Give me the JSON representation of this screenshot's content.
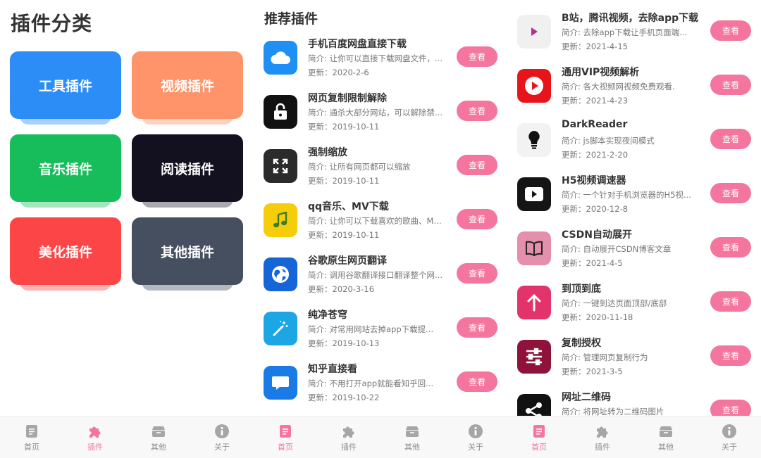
{
  "screen1": {
    "title": "插件分类",
    "categories": [
      {
        "label": "工具插件",
        "color": "#2d8df6",
        "shadow": "#a9d0fb"
      },
      {
        "label": "视频插件",
        "color": "#ff946b",
        "shadow": "#ffd2c0"
      },
      {
        "label": "音乐插件",
        "color": "#17bd5a",
        "shadow": "#a3e6bd"
      },
      {
        "label": "阅读插件",
        "color": "#13111f",
        "shadow": "#a9a8ae"
      },
      {
        "label": "美化插件",
        "color": "#fb4547",
        "shadow": "#fdb3b4"
      },
      {
        "label": "其他插件",
        "color": "#454f60",
        "shadow": "#b4b9c0"
      }
    ]
  },
  "screen2": {
    "title": "推荐插件",
    "items": [
      {
        "name": "手机百度网盘直接下载",
        "desc": "简介: 让你可以直接下载网盘文件，...",
        "date": "更新：2020-2-6",
        "btn": "查看",
        "icon": "cloud-icon"
      },
      {
        "name": "网页复制限制解除",
        "desc": "简介: 通杀大部分网站，可以解除禁...",
        "date": "更新：2019-10-11",
        "btn": "查看",
        "icon": "lock-icon"
      },
      {
        "name": "强制缩放",
        "desc": "简介: 让所有网页都可以缩放",
        "date": "更新：2019-10-11",
        "btn": "查看",
        "icon": "expand-icon"
      },
      {
        "name": "qq音乐、MV下载",
        "desc": "简介: 让你可以下载喜欢的歌曲、M...",
        "date": "更新：2019-10-11",
        "btn": "查看",
        "icon": "music-note-icon"
      },
      {
        "name": "谷歌原生网页翻译",
        "desc": "简介: 调用谷歌翻译接口翻译整个网...",
        "date": "更新：2020-3-16",
        "btn": "查看",
        "icon": "globe-icon"
      },
      {
        "name": "纯净苍穹",
        "desc": "简介: 对常用网站去掉app下载提...",
        "date": "更新：2019-10-13",
        "btn": "查看",
        "icon": "magic-wand-icon"
      },
      {
        "name": "知乎直接看",
        "desc": "简介: 不用打开app就能看知乎回...",
        "date": "更新：2019-10-22",
        "btn": "查看",
        "icon": "chat-bubble-icon"
      }
    ]
  },
  "screen3": {
    "items": [
      {
        "name": "B站，腾讯视频，去除app下载",
        "desc": "简介: 去除app下载让手机页面端...",
        "date": "更新：2021-4-15",
        "btn": "查看",
        "icon": "play-triangle-icon"
      },
      {
        "name": "通用VIP视频解析",
        "desc": "简介: 各大视频网视频免费观看.",
        "date": "更新：2021-4-23",
        "btn": "查看",
        "icon": "play-circle-icon"
      },
      {
        "name": "DarkReader",
        "desc": "简介: js脚本实现夜间模式",
        "date": "更新：2021-2-20",
        "btn": "查看",
        "icon": "lightbulb-icon"
      },
      {
        "name": "H5视频调速器",
        "desc": "简介: 一个针对手机浏览器的H5视...",
        "date": "更新：2020-12-8",
        "btn": "查看",
        "icon": "video-play-icon"
      },
      {
        "name": "CSDN自动展开",
        "desc": "简介: 自动展开CSDN博客文章",
        "date": "更新：2021-4-5",
        "btn": "查看",
        "icon": "book-icon"
      },
      {
        "name": "到顶到底",
        "desc": "简介: 一键到达页面顶部/底部",
        "date": "更新：2020-11-18",
        "btn": "查看",
        "icon": "arrow-up-icon"
      },
      {
        "name": "复制授权",
        "desc": "简介: 管理网页复制行为",
        "date": "更新：2021-3-5",
        "btn": "查看",
        "icon": "sliders-icon"
      },
      {
        "name": "网址二维码",
        "desc": "简介: 将网址转为二维码图片",
        "date": "",
        "btn": "查看",
        "icon": "share-icon"
      }
    ]
  },
  "tabbar": {
    "tabs": [
      {
        "label": "首页",
        "icon": "document-icon"
      },
      {
        "label": "插件",
        "icon": "puzzle-icon"
      },
      {
        "label": "其他",
        "icon": "box-icon"
      },
      {
        "label": "关于",
        "icon": "info-icon"
      }
    ],
    "active_by_screen": [
      1,
      0,
      0
    ]
  },
  "colors": {
    "accent": "#f4759e",
    "tab_inactive": "#8c8c8c"
  }
}
